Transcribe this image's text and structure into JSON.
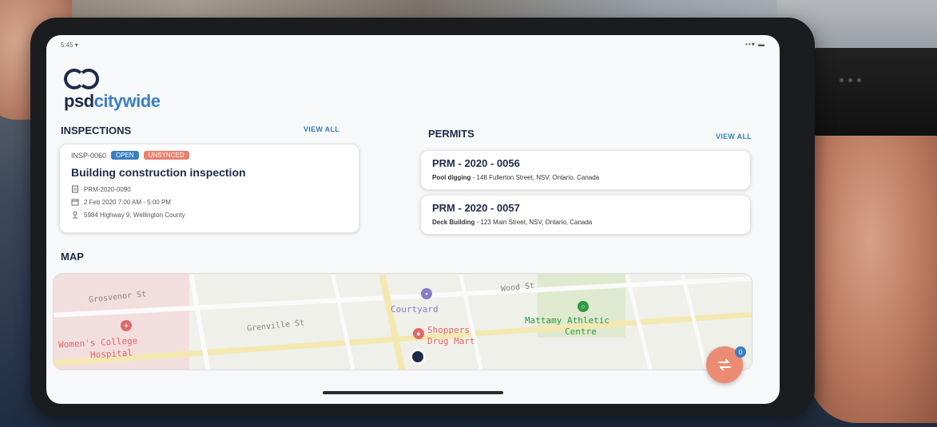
{
  "status_bar": {
    "time": "5:45 ▾",
    "icons": "••▾ ▬"
  },
  "brand": {
    "prefix": "psd",
    "suffix": "citywide"
  },
  "inspections": {
    "title": "INSPECTIONS",
    "view_all": "VIEW ALL",
    "card": {
      "id": "INSP-0060",
      "status": "OPEN",
      "sync": "UNSYNCED",
      "title": "Building construction inspection",
      "permit": "PRM-2020-0090",
      "datetime": "2 Feb 2020 7:00 AM - 5:00 PM",
      "address": "5984 Highway 9, Wellington County"
    }
  },
  "permits": {
    "title": "PERMITS",
    "view_all": "VIEW ALL",
    "items": [
      {
        "title": "PRM - 2020 - 0056",
        "type": "Pool digging",
        "address": " - 148 Fullerton Street, NSV, Ontario, Canada"
      },
      {
        "title": "PRM - 2020 - 0057",
        "type": "Deck Building",
        "address": " - 123 Main Street, NSV, Ontario, Canada"
      }
    ]
  },
  "map": {
    "title": "MAP",
    "labels": {
      "grosvenor": "Grosvenor St",
      "grenville": "Grenville St",
      "wood": "Wood St",
      "courtyard": "Courtyard",
      "shoppers_1": "Shoppers",
      "shoppers_2": "Drug Mart",
      "mattamy_1": "Mattamy Athletic",
      "mattamy_2": "Centre",
      "hospital_1": "Women's College",
      "hospital_2": "Hospital"
    }
  },
  "fab": {
    "badge": "0"
  },
  "colors": {
    "navy": "#1e2a4a",
    "blue": "#3a7fc1",
    "salmon": "#ec8b74",
    "green": "#2f9a3f",
    "hospital": "#e06868",
    "purple": "#8a7cc7"
  }
}
